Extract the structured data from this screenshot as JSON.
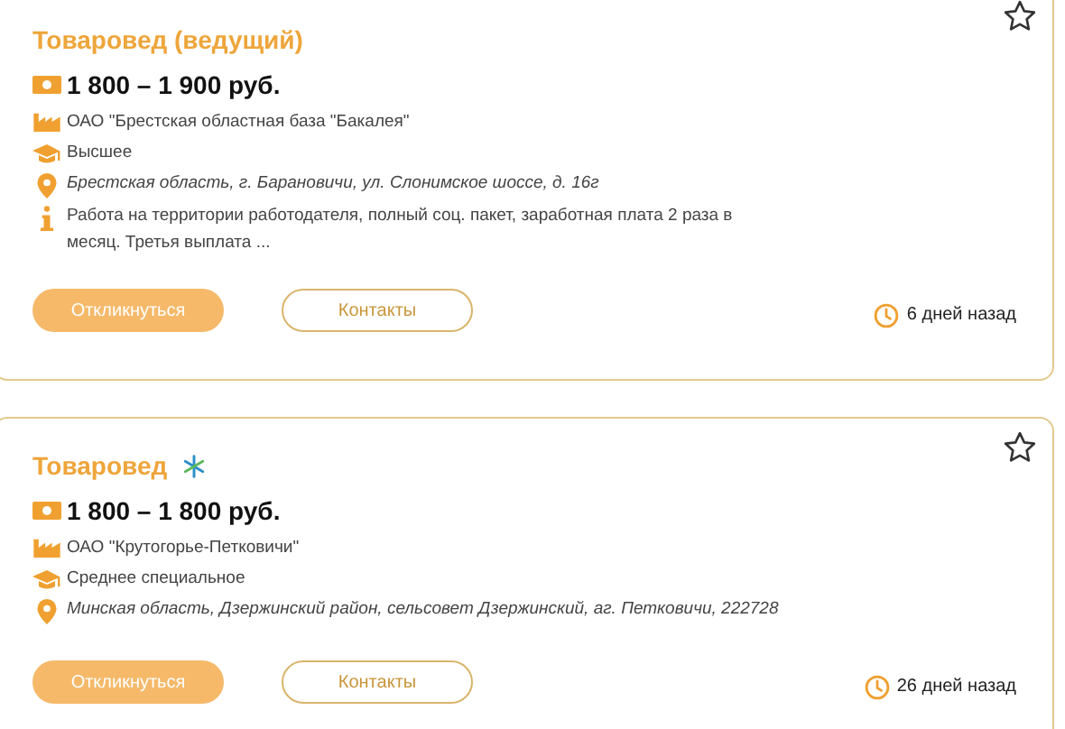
{
  "vacancies": [
    {
      "title": "Товаровед (ведущий)",
      "featured": false,
      "salary": "1 800 – 1 900 руб.",
      "details": [
        {
          "kind": "company",
          "text": "ОАО \"Брестская областная база \"Бакалея\""
        },
        {
          "kind": "education",
          "text": "Высшее"
        },
        {
          "kind": "address",
          "text": "Брестская область, г. Барановичи, ул. Слонимское шоссе, д. 16г"
        },
        {
          "kind": "info",
          "text": "Работа на территории работодателя, полный соц. пакет, заработная плата 2 раза в месяц. Третья выплата ..."
        }
      ],
      "respond_button": "Откликнуться",
      "contacts_button": "Контакты",
      "posted": "6 дней назад"
    },
    {
      "title": "Товаровед",
      "featured": true,
      "salary": "1 800 – 1 800 руб.",
      "details": [
        {
          "kind": "company",
          "text": "ОАО \"Крутогорье-Петковичи\""
        },
        {
          "kind": "education",
          "text": "Среднее специальное"
        },
        {
          "kind": "address",
          "text": "Минская область, Дзержинский район, сельсовет Дзержинский, аг. Петковичи, 222728"
        }
      ],
      "respond_button": "Откликнуться",
      "contacts_button": "Контакты",
      "posted": "26 дней назад"
    }
  ]
}
